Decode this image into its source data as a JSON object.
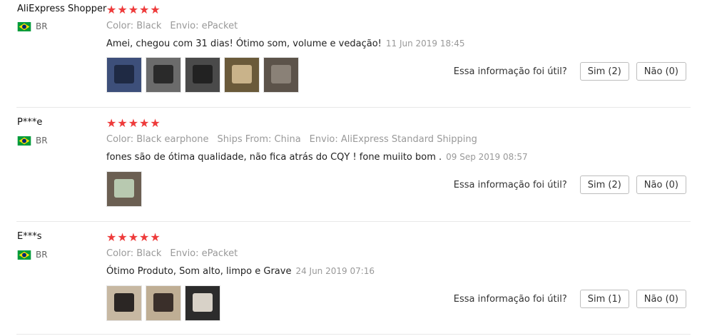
{
  "reviews": [
    {
      "name": "AliExpress Shopper",
      "country": "BR",
      "stars": 5,
      "meta": [
        {
          "key": "Color:",
          "value": "Black"
        },
        {
          "key": "Envio:",
          "value": "ePacket"
        }
      ],
      "text": "Amei, chegou com 31 dias! Ótimo som, volume e vedação!",
      "date": "11 Jun 2019 18:45",
      "photos": 5,
      "helpful_question": "Essa informação foi útil?",
      "yes": "Sim (2)",
      "no": "Não (0)"
    },
    {
      "name": "P***e",
      "country": "BR",
      "stars": 5,
      "meta": [
        {
          "key": "Color:",
          "value": "Black earphone"
        },
        {
          "key": "Ships From:",
          "value": "China"
        },
        {
          "key": "Envio:",
          "value": "AliExpress Standard Shipping"
        }
      ],
      "text": "fones são de ótima qualidade, não fica atrás do CQY ! fone muiito bom .",
      "date": "09 Sep 2019 08:57",
      "photos": 1,
      "helpful_question": "Essa informação foi útil?",
      "yes": "Sim (2)",
      "no": "Não (0)"
    },
    {
      "name": "E***s",
      "country": "BR",
      "stars": 5,
      "meta": [
        {
          "key": "Color:",
          "value": "Black"
        },
        {
          "key": "Envio:",
          "value": "ePacket"
        }
      ],
      "text": "Ótimo Produto, Som alto, limpo e Grave",
      "date": "24 Jun 2019 07:16",
      "photos": 3,
      "helpful_question": "Essa informação foi útil?",
      "yes": "Sim (1)",
      "no": "Não (0)"
    }
  ],
  "star_icon": "star-icon",
  "flag_icon": "brazil-flag-icon"
}
